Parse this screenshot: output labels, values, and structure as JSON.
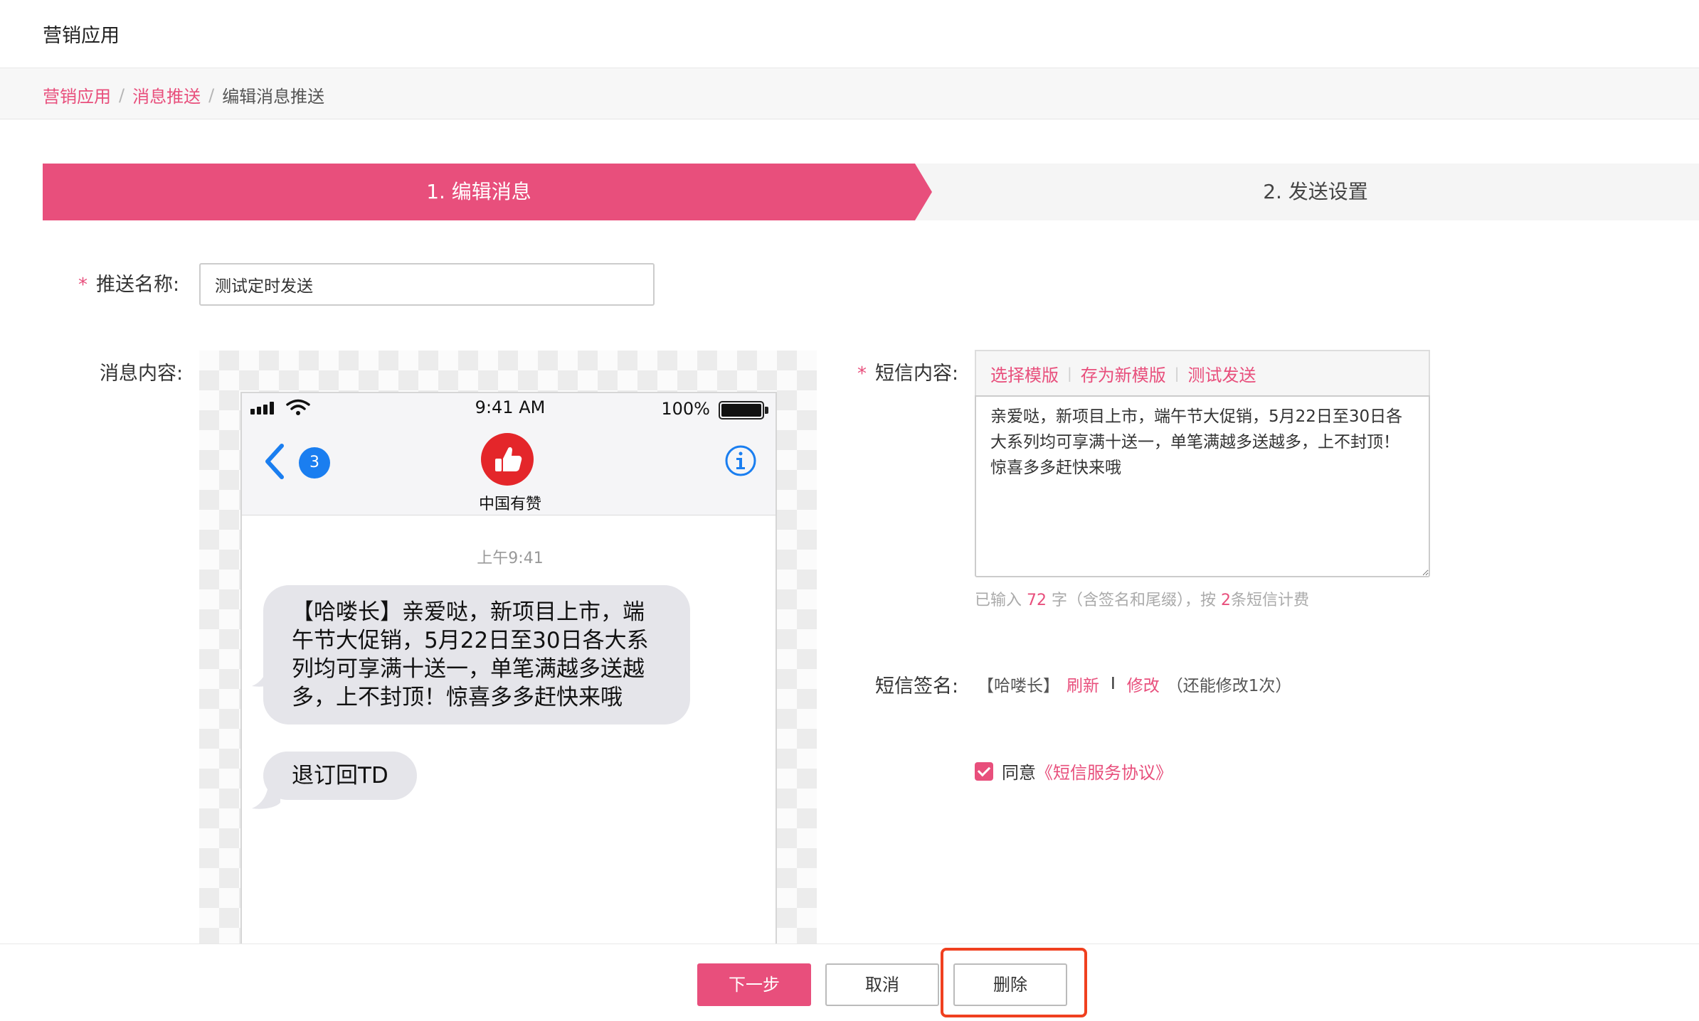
{
  "app": {
    "title": "营销应用"
  },
  "breadcrumb": {
    "items": [
      "营销应用",
      "消息推送"
    ],
    "separator": "/",
    "current": "编辑消息推送"
  },
  "steps": [
    {
      "label": "1. 编辑消息",
      "active": true
    },
    {
      "label": "2. 发送设置",
      "active": false
    }
  ],
  "form": {
    "required_mark": "*",
    "name": {
      "label": "推送名称:",
      "value": "测试定时发送"
    },
    "message_content_label": "消息内容:",
    "sms_content": {
      "label": "短信内容:",
      "toolbar": [
        "选择模版",
        "存为新模版",
        "测试发送"
      ],
      "text": "亲爱哒，新项目上市，端午节大促销，5月22日至30日各大系列均可享满十送一，单笔满越多送越多，上不封顶！惊喜多多赶快来哦",
      "count": {
        "prefix": "已输入",
        "chars": "72",
        "middle": "字（含签名和尾缀），按",
        "messages": "2",
        "suffix": "条短信计费"
      }
    },
    "signature": {
      "label": "短信签名:",
      "value": "【哈喽长】",
      "refresh": "刷新",
      "divider": "I",
      "edit": "修改",
      "note": "（还能修改1次）"
    },
    "agreement": {
      "checked": true,
      "text": "同意",
      "link": "《短信服务协议》"
    }
  },
  "phone": {
    "time": "9:41 AM",
    "battery": "100%",
    "back_count": "3",
    "contact": "中国有赞",
    "message_time": "上午9:41",
    "messages": [
      "【哈喽长】亲爱哒，新项目上市，端午节大促销，5月22日至30日各大系列均可享满十送一，单笔满越多送越多，上不封顶！惊喜多多赶快来哦",
      "退订回TD"
    ]
  },
  "footer": {
    "next": "下一步",
    "cancel": "取消",
    "delete": "删除"
  },
  "colors": {
    "accent": "#e84f7c",
    "highlight": "#f0401f",
    "ios_blue": "#1a7ef0",
    "avatar_red": "#e4262a"
  },
  "icons": [
    "signal-icon",
    "wifi-icon",
    "battery-icon",
    "back-chevron-icon",
    "thumbs-up-icon",
    "info-icon",
    "checkbox-checked-icon"
  ]
}
